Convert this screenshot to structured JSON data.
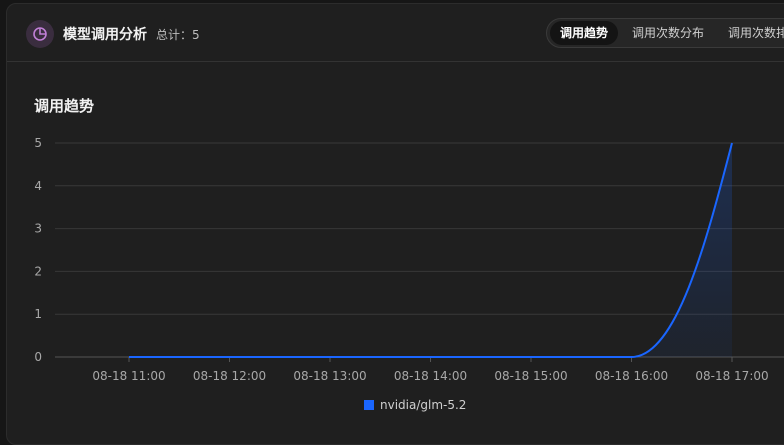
{
  "header": {
    "icon": "pie-chart-icon",
    "title": "模型调用分析",
    "total": "总计：5"
  },
  "tabs": [
    {
      "label": "调用趋势",
      "active": true
    },
    {
      "label": "调用次数分布",
      "active": false
    },
    {
      "label": "调用次数排行",
      "active": false
    }
  ],
  "section_title": "调用趋势",
  "colors": {
    "series": "#1a66ff",
    "grid": "#3a3a3a",
    "accent_icon": "#c07fd6"
  },
  "chart_data": {
    "type": "area",
    "title": "",
    "xlabel": "",
    "ylabel": "",
    "categories": [
      "08-18 11:00",
      "08-18 12:00",
      "08-18 13:00",
      "08-18 14:00",
      "08-18 15:00",
      "08-18 16:00",
      "08-18 17:00"
    ],
    "y_ticks": [
      "0",
      "1",
      "2",
      "3",
      "4",
      "5"
    ],
    "ylim": [
      0,
      5
    ],
    "grid": true,
    "legend_position": "bottom",
    "series": [
      {
        "name": "nvidia/glm-5.2",
        "values": [
          0,
          0,
          0,
          0,
          0,
          0,
          5
        ]
      }
    ]
  }
}
